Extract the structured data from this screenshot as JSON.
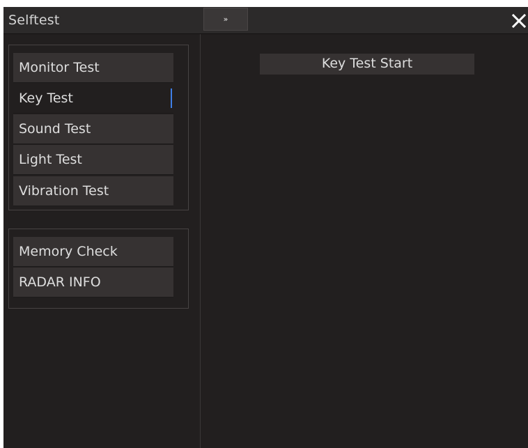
{
  "window": {
    "title": "Selftest",
    "expand_label": "»",
    "close_icon": "close-icon"
  },
  "sidebar": {
    "group1": [
      {
        "label": "Monitor Test",
        "selected": false
      },
      {
        "label": "Key Test",
        "selected": true
      },
      {
        "label": "Sound Test",
        "selected": false
      },
      {
        "label": "Light Test",
        "selected": false
      },
      {
        "label": "Vibration Test",
        "selected": false
      }
    ],
    "group2": [
      {
        "label": "Memory Check",
        "selected": false
      },
      {
        "label": "RADAR INFO",
        "selected": false
      }
    ]
  },
  "main": {
    "start_button_label": "Key Test Start"
  },
  "colors": {
    "background": "#221f1f",
    "button": "#363232",
    "selection_marker": "#3f7fe6"
  }
}
